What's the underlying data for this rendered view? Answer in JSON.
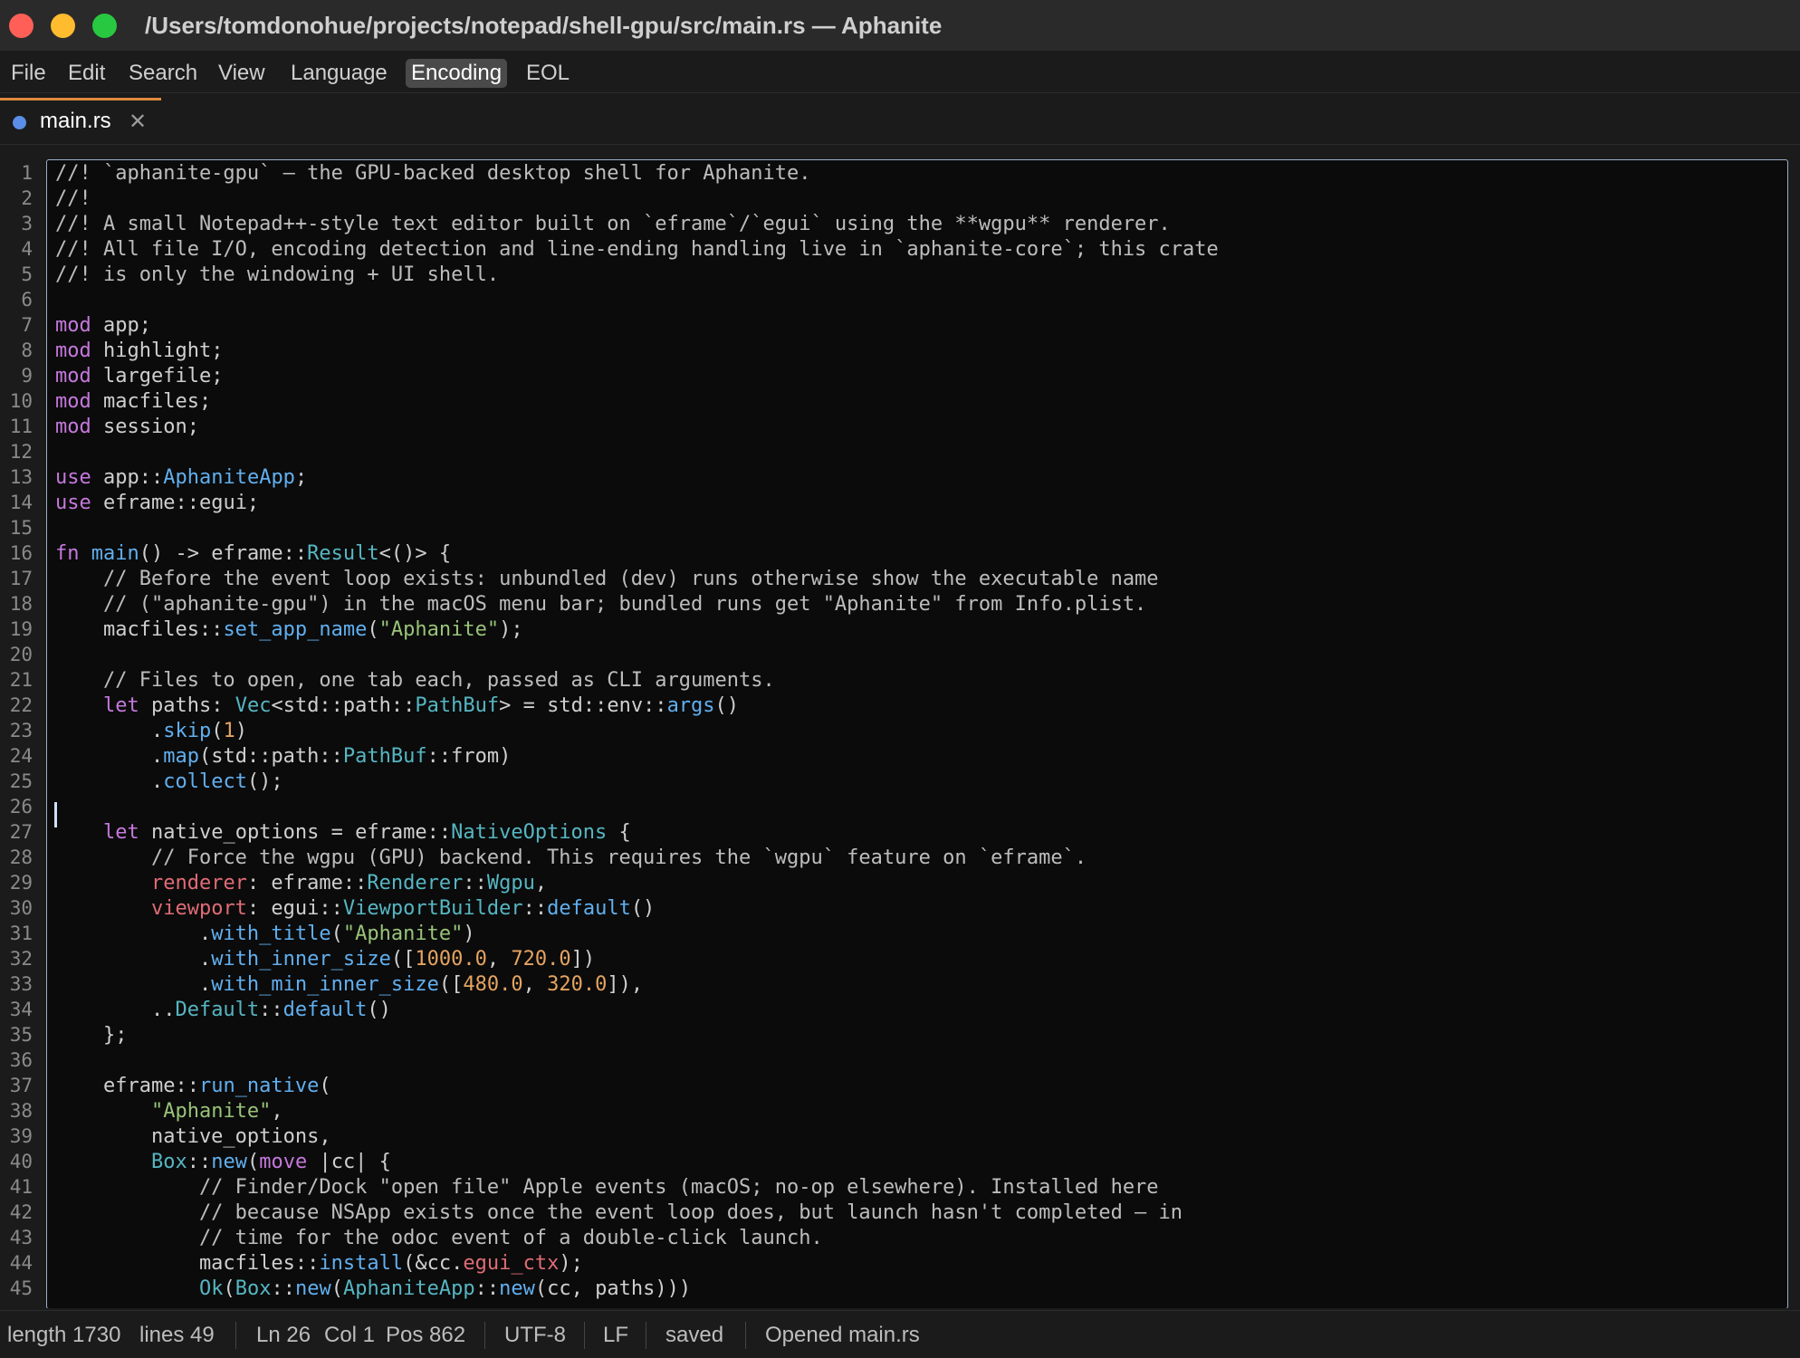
{
  "window": {
    "title": "/Users/tomdonohue/projects/notepad/shell-gpu/src/main.rs — Aphanite"
  },
  "menu": {
    "items": [
      {
        "label": "File"
      },
      {
        "label": "Edit"
      },
      {
        "label": "Search"
      },
      {
        "label": "View"
      },
      {
        "label": "Language"
      },
      {
        "label": "Encoding",
        "active": true
      },
      {
        "label": "EOL"
      }
    ]
  },
  "tabs": [
    {
      "label": "main.rs",
      "close": "✕",
      "dot_color": "#5b8ee6"
    }
  ],
  "editor": {
    "cursor_line": 26,
    "lines": [
      [
        [
          "cm",
          "//! `aphanite-gpu` — the GPU-backed desktop shell for Aphanite."
        ]
      ],
      [
        [
          "cm",
          "//!"
        ]
      ],
      [
        [
          "cm",
          "//! A small Notepad++-style text editor built on `eframe`/`egui` using the **wgpu** renderer."
        ]
      ],
      [
        [
          "cm",
          "//! All file I/O, encoding detection and line-ending handling live in `aphanite-core`; this crate"
        ]
      ],
      [
        [
          "cm",
          "//! is only the windowing + UI shell."
        ]
      ],
      [],
      [
        [
          "kw",
          "mod"
        ],
        [
          "txt",
          " app;"
        ]
      ],
      [
        [
          "kw",
          "mod"
        ],
        [
          "txt",
          " highlight;"
        ]
      ],
      [
        [
          "kw",
          "mod"
        ],
        [
          "txt",
          " largefile;"
        ]
      ],
      [
        [
          "kw",
          "mod"
        ],
        [
          "txt",
          " macfiles;"
        ]
      ],
      [
        [
          "kw",
          "mod"
        ],
        [
          "txt",
          " session;"
        ]
      ],
      [],
      [
        [
          "kw",
          "use"
        ],
        [
          "txt",
          " app::"
        ],
        [
          "fn",
          "AphaniteApp"
        ],
        [
          "txt",
          ";"
        ]
      ],
      [
        [
          "kw",
          "use"
        ],
        [
          "txt",
          " eframe::egui;"
        ]
      ],
      [],
      [
        [
          "kw",
          "fn"
        ],
        [
          "txt",
          " "
        ],
        [
          "fn",
          "main"
        ],
        [
          "txt",
          "() -> eframe::"
        ],
        [
          "ty",
          "Result"
        ],
        [
          "txt",
          "<()> {"
        ]
      ],
      [
        [
          "cm",
          "    // Before the event loop exists: unbundled (dev) runs otherwise show the executable name"
        ]
      ],
      [
        [
          "cm",
          "    // (\"aphanite-gpu\") in the macOS menu bar; bundled runs get \"Aphanite\" from Info.plist."
        ]
      ],
      [
        [
          "txt",
          "    macfiles::"
        ],
        [
          "fn",
          "set_app_name"
        ],
        [
          "txt",
          "("
        ],
        [
          "str",
          "\"Aphanite\""
        ],
        [
          "txt",
          ");"
        ]
      ],
      [],
      [
        [
          "cm",
          "    // Files to open, one tab each, passed as CLI arguments."
        ]
      ],
      [
        [
          "txt",
          "    "
        ],
        [
          "kw",
          "let"
        ],
        [
          "txt",
          " paths: "
        ],
        [
          "ty",
          "Vec"
        ],
        [
          "txt",
          "<std::path::"
        ],
        [
          "ty",
          "PathBuf"
        ],
        [
          "txt",
          "> = std::env::"
        ],
        [
          "fn",
          "args"
        ],
        [
          "txt",
          "()"
        ]
      ],
      [
        [
          "txt",
          "        ."
        ],
        [
          "fn",
          "skip"
        ],
        [
          "txt",
          "("
        ],
        [
          "num",
          "1"
        ],
        [
          "txt",
          ")"
        ]
      ],
      [
        [
          "txt",
          "        ."
        ],
        [
          "fn",
          "map"
        ],
        [
          "txt",
          "(std::path::"
        ],
        [
          "ty",
          "PathBuf"
        ],
        [
          "txt",
          "::from)"
        ]
      ],
      [
        [
          "txt",
          "        ."
        ],
        [
          "fn",
          "collect"
        ],
        [
          "txt",
          "();"
        ]
      ],
      [],
      [
        [
          "txt",
          "    "
        ],
        [
          "kw",
          "let"
        ],
        [
          "txt",
          " native_options = eframe::"
        ],
        [
          "ty",
          "NativeOptions"
        ],
        [
          "txt",
          " {"
        ]
      ],
      [
        [
          "cm",
          "        // Force the wgpu (GPU) backend. This requires the `wgpu` feature on `eframe`."
        ]
      ],
      [
        [
          "txt",
          "        "
        ],
        [
          "fld",
          "renderer"
        ],
        [
          "txt",
          ": eframe::"
        ],
        [
          "ty",
          "Renderer"
        ],
        [
          "txt",
          "::"
        ],
        [
          "ty",
          "Wgpu"
        ],
        [
          "txt",
          ","
        ]
      ],
      [
        [
          "txt",
          "        "
        ],
        [
          "fld",
          "viewport"
        ],
        [
          "txt",
          ": egui::"
        ],
        [
          "ty",
          "ViewportBuilder"
        ],
        [
          "txt",
          "::"
        ],
        [
          "fn",
          "default"
        ],
        [
          "txt",
          "()"
        ]
      ],
      [
        [
          "txt",
          "            ."
        ],
        [
          "fn",
          "with_title"
        ],
        [
          "txt",
          "("
        ],
        [
          "str",
          "\"Aphanite\""
        ],
        [
          "txt",
          ")"
        ]
      ],
      [
        [
          "txt",
          "            ."
        ],
        [
          "fn",
          "with_inner_size"
        ],
        [
          "txt",
          "(["
        ],
        [
          "num",
          "1000.0"
        ],
        [
          "txt",
          ", "
        ],
        [
          "num",
          "720.0"
        ],
        [
          "txt",
          "])"
        ]
      ],
      [
        [
          "txt",
          "            ."
        ],
        [
          "fn",
          "with_min_inner_size"
        ],
        [
          "txt",
          "(["
        ],
        [
          "num",
          "480.0"
        ],
        [
          "txt",
          ", "
        ],
        [
          "num",
          "320.0"
        ],
        [
          "txt",
          "]),"
        ]
      ],
      [
        [
          "txt",
          "        .."
        ],
        [
          "ty",
          "Default"
        ],
        [
          "txt",
          "::"
        ],
        [
          "fn",
          "default"
        ],
        [
          "txt",
          "()"
        ]
      ],
      [
        [
          "txt",
          "    };"
        ]
      ],
      [],
      [
        [
          "txt",
          "    eframe::"
        ],
        [
          "fn",
          "run_native"
        ],
        [
          "txt",
          "("
        ]
      ],
      [
        [
          "txt",
          "        "
        ],
        [
          "str",
          "\"Aphanite\""
        ],
        [
          "txt",
          ","
        ]
      ],
      [
        [
          "txt",
          "        native_options,"
        ]
      ],
      [
        [
          "txt",
          "        "
        ],
        [
          "ty",
          "Box"
        ],
        [
          "txt",
          "::"
        ],
        [
          "fn",
          "new"
        ],
        [
          "txt",
          "("
        ],
        [
          "kw",
          "move"
        ],
        [
          "txt",
          " |cc| {"
        ]
      ],
      [
        [
          "cm",
          "            // Finder/Dock \"open file\" Apple events (macOS; no-op elsewhere). Installed here"
        ]
      ],
      [
        [
          "cm",
          "            // because NSApp exists once the event loop does, but launch hasn't completed — in"
        ]
      ],
      [
        [
          "cm",
          "            // time for the odoc event of a double-click launch."
        ]
      ],
      [
        [
          "txt",
          "            macfiles::"
        ],
        [
          "fn",
          "install"
        ],
        [
          "txt",
          "(&cc."
        ],
        [
          "fld",
          "egui_ctx"
        ],
        [
          "txt",
          ");"
        ]
      ],
      [
        [
          "txt",
          "            "
        ],
        [
          "ty",
          "Ok"
        ],
        [
          "txt",
          "("
        ],
        [
          "ty",
          "Box"
        ],
        [
          "txt",
          "::"
        ],
        [
          "fn",
          "new"
        ],
        [
          "txt",
          "("
        ],
        [
          "ty",
          "AphaniteApp"
        ],
        [
          "txt",
          "::"
        ],
        [
          "fn",
          "new"
        ],
        [
          "txt",
          "(cc, paths)))"
        ]
      ]
    ]
  },
  "status": {
    "length": "length 1730",
    "lines": "lines 49",
    "ln": "Ln 26",
    "col": "Col 1",
    "pos": "Pos 862",
    "encoding": "UTF-8",
    "eol": "LF",
    "saved": "saved",
    "message": "Opened main.rs"
  }
}
